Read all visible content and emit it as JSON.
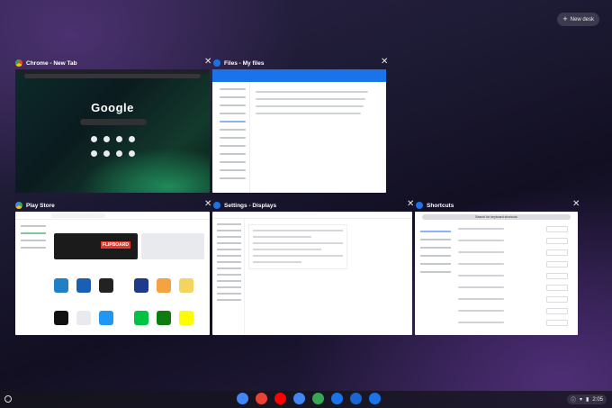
{
  "desk": {
    "new_desk_label": "New desk",
    "plus": "+"
  },
  "windows": {
    "chrome": {
      "title": "Chrome - New Tab",
      "logo_text": "Google"
    },
    "files": {
      "title": "Files - My files"
    },
    "play": {
      "title": "Play Store",
      "flip_label": "FLIPBOARD"
    },
    "settings": {
      "title": "Settings - Displays"
    },
    "shortcuts": {
      "title": "Shortcuts",
      "search_placeholder": "Search for keyboard shortcuts"
    }
  },
  "close_glyph": "✕",
  "shelf": {
    "apps": [
      {
        "name": "chrome-icon",
        "color": "#4285f4"
      },
      {
        "name": "gmail-icon",
        "color": "#ea4335"
      },
      {
        "name": "youtube-icon",
        "color": "#ff0000"
      },
      {
        "name": "docs-icon",
        "color": "#4285f4"
      },
      {
        "name": "play-store-icon",
        "color": "#34a853"
      },
      {
        "name": "files-icon",
        "color": "#1a73e8"
      },
      {
        "name": "camera-icon",
        "color": "#1967d2"
      },
      {
        "name": "settings-icon",
        "color": "#1a73e8"
      }
    ],
    "time": "2:05"
  }
}
